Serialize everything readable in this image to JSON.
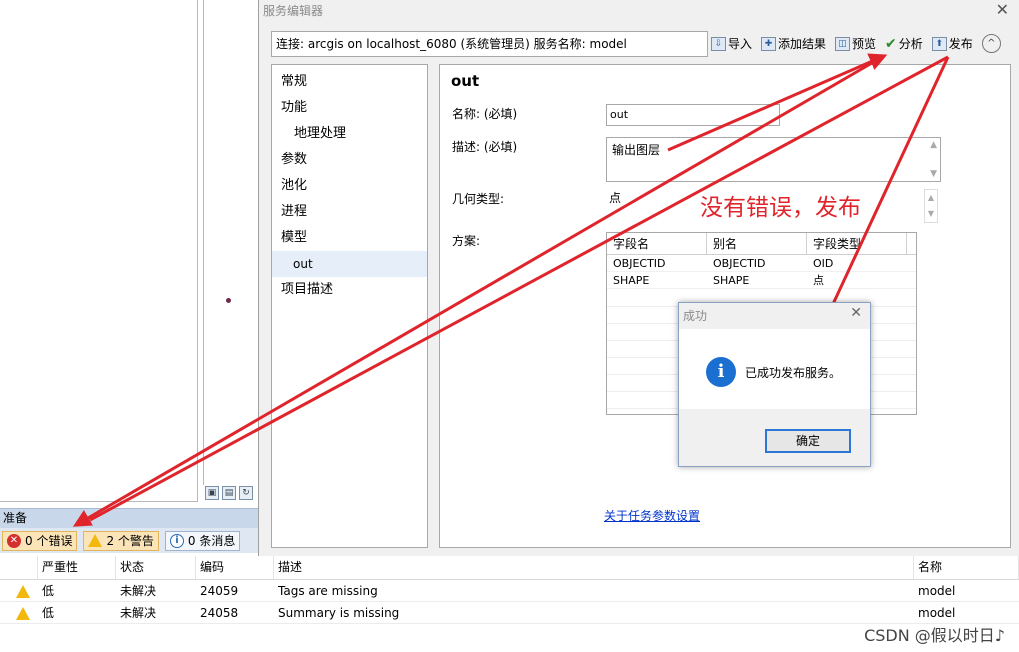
{
  "dialog": {
    "title": "服务编辑器",
    "close": "✕",
    "connection": "连接: arcgis on localhost_6080 (系统管理员)    服务名称: model",
    "toolbar": [
      {
        "label": "导入",
        "icon": "import-icon"
      },
      {
        "label": "添加结果",
        "icon": "add-results-icon"
      },
      {
        "label": "预览",
        "icon": "preview-icon"
      },
      {
        "label": "分析",
        "icon": "analyze-check-icon"
      },
      {
        "label": "发布",
        "icon": "publish-icon"
      }
    ],
    "collapse": "^"
  },
  "nav": {
    "items": [
      "常规",
      "功能",
      "地理处理",
      "参数",
      "池化",
      "进程",
      "模型",
      "out",
      "项目描述"
    ]
  },
  "content": {
    "title": "out",
    "name_label": "名称: (必填)",
    "name_value": "out",
    "desc_label": "描述: (必填)",
    "desc_value": "输出图层",
    "geom_label": "几何类型:",
    "geom_value": "点",
    "schema_label": "方案:",
    "schema_headers": [
      "字段名",
      "别名",
      "字段类型"
    ],
    "schema_rows": [
      [
        "OBJECTID",
        "OBJECTID",
        "OID"
      ],
      [
        "SHAPE",
        "SHAPE",
        "点"
      ]
    ],
    "link": "关于任务参数设置"
  },
  "modal": {
    "title": "成功",
    "close": "✕",
    "icon": "i",
    "message": "已成功发布服务。",
    "ok": "确定"
  },
  "annotation": "没有错误，发布",
  "status": {
    "text": "准备",
    "errors": "0 个错误",
    "warnings": "2 个警告",
    "messages": "0 条消息"
  },
  "issues": {
    "headers": [
      "",
      "严重性",
      "状态",
      "编码",
      "描述",
      "名称"
    ],
    "rows": [
      {
        "severity": "低",
        "status": "未解决",
        "code": "24059",
        "desc": "Tags are missing",
        "name": "model"
      },
      {
        "severity": "低",
        "status": "未解决",
        "code": "24058",
        "desc": "Summary is missing",
        "name": "model"
      }
    ]
  },
  "watermark": "CSDN @假以时日♪",
  "colors": {
    "annotation_red": "#e0242b",
    "link_blue": "#0033cc",
    "status_bar": "#c9d7ea"
  }
}
